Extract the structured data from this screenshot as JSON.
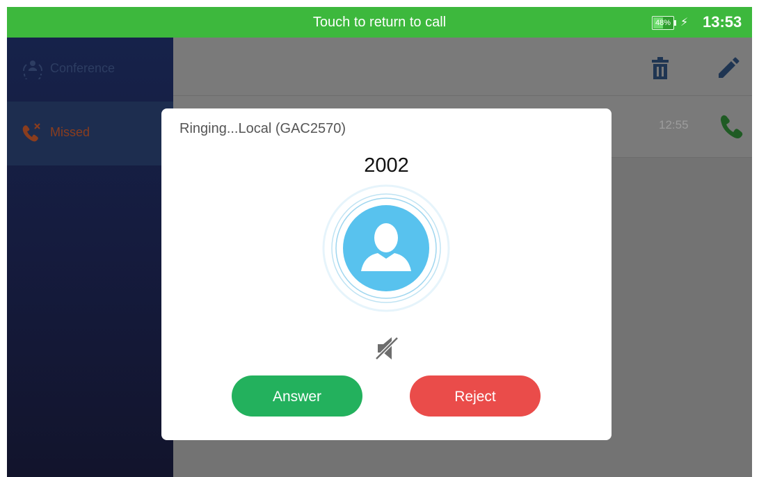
{
  "statusbar": {
    "banner": "Touch to return to call",
    "battery": "48%",
    "battery_level": 0.48,
    "clock": "13:53",
    "color": "#3db83d"
  },
  "sidebar": {
    "items": [
      {
        "label": "Conference",
        "icon": "conference-icon",
        "color": "#2d3d62"
      },
      {
        "label": "Missed",
        "icon": "missed-call-icon",
        "color": "#8a3d1e",
        "selected": true
      }
    ]
  },
  "toolbar": {
    "delete_icon": "trash-icon",
    "edit_icon": "pencil-icon"
  },
  "call_log": {
    "rows": [
      {
        "time": "12:55",
        "icon": "phone-icon"
      }
    ]
  },
  "incoming_call": {
    "status": "Ringing...Local (GAC2570)",
    "number": "2002",
    "avatar_icon": "contact-avatar-icon",
    "mute_icon": "speaker-muted-icon",
    "answer_label": "Answer",
    "reject_label": "Reject",
    "answer_color": "#23b15d",
    "reject_color": "#ea4c4a"
  }
}
